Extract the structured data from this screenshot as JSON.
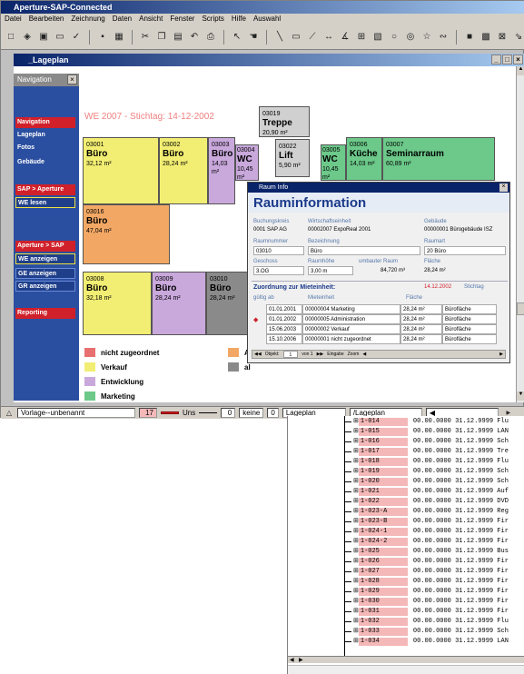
{
  "app": {
    "title": "Aperture-SAP-Connected",
    "menu": [
      "Datei",
      "Bearbeiten",
      "Zeichnung",
      "Daten",
      "Ansicht",
      "Fenster",
      "Scripts",
      "Hilfe",
      "Auswahl"
    ]
  },
  "child_window": {
    "title": "_Lageplan"
  },
  "nav_panel": {
    "title": "Navigation",
    "items": [
      "Navigation",
      "Lageplan",
      "Fotos",
      "Gebäude",
      "SAP > Aperture",
      "WE lesen",
      "Aperture > SAP",
      "WE anzeigen",
      "GE anzeigen",
      "GR anzeigen",
      "Reporting"
    ]
  },
  "plan": {
    "header": "WE 2007 - Stichtag: 14-12-2002",
    "rooms": [
      {
        "num": "03001",
        "name": "Büro",
        "area": "32,12 m²",
        "color": "#f2ee73"
      },
      {
        "num": "03002",
        "name": "Büro",
        "area": "28,24 m²",
        "color": "#f2ee73"
      },
      {
        "num": "03003",
        "name": "Büro",
        "area": "14,03 m²",
        "color": "#c9a8dc"
      },
      {
        "num": "03004",
        "name": "WC",
        "area": "10,45 m²",
        "color": "#c9a8dc"
      },
      {
        "num": "03019",
        "name": "Treppe",
        "area": "20,90 m²",
        "color": "#d0d0d0"
      },
      {
        "num": "03022",
        "name": "Lift",
        "area": "5,90 m²",
        "color": "#d0d0d0"
      },
      {
        "num": "03005",
        "name": "WC",
        "area": "10,45 m²",
        "color": "#6cc98a"
      },
      {
        "num": "03006",
        "name": "Küche",
        "area": "14,03 m²",
        "color": "#6cc98a"
      },
      {
        "num": "03007",
        "name": "Seminarraum",
        "area": "60,89 m²",
        "color": "#6cc98a"
      },
      {
        "num": "03016",
        "name": "Büro",
        "area": "47,04 m²",
        "color": "#f2a864"
      },
      {
        "num": "03008",
        "name": "Büro",
        "area": "32,18 m²",
        "color": "#f2ee73"
      },
      {
        "num": "03009",
        "name": "Büro",
        "area": "28,24 m²",
        "color": "#c9a8dc"
      },
      {
        "num": "03010",
        "name": "Büro",
        "area": "28,24 m²",
        "color": "#8a8a8a"
      }
    ],
    "legend": [
      {
        "label": "nicht zugeordnet",
        "color": "#e87070"
      },
      {
        "label": "Verkauf",
        "color": "#f2ee73"
      },
      {
        "label": "Entwicklung",
        "color": "#c9a8dc"
      },
      {
        "label": "Marketing",
        "color": "#6cc98a"
      },
      {
        "label": "A",
        "color": "#f2a864"
      },
      {
        "label": "al",
        "color": "#8a8a8a"
      }
    ]
  },
  "status_bar": {
    "vorlage": "Vorlage--unbenannt",
    "num1": "17",
    "uns": "Uns",
    "zero1": "0",
    "keine": "keine",
    "zero2": "0",
    "lageplan1": "Lageplan",
    "lageplan2": "/Lageplan"
  },
  "dialog": {
    "title": "Raum Info",
    "heading": "Rauminformation",
    "fields": {
      "buchungskreis_label": "Buchungskreis",
      "buchungskreis": "0001 SAP AG",
      "wirtschaft_label": "Wirtschaftseinheit",
      "wirtschaft": "00002007 ExpoReal 2001",
      "gebaeude_label": "Gebäude",
      "gebaeude": "00000001 Bürogebäude ISZ",
      "raumnummer_label": "Raumnummer",
      "raumnummer": "03010",
      "bezeichnung_label": "Bezeichnung",
      "bezeichnung": "Büro",
      "raumart_label": "Raumart",
      "raumart": "20 Büro",
      "geschoss_label": "Geschoss",
      "geschoss": "3.OG",
      "raumhoehe_label": "Raumhöhe",
      "raumhoehe": "3,00 m",
      "umbauter_label": "umbauter Raum",
      "umbauter": "84,720 m³",
      "flaeche_label": "Fläche",
      "flaeche": "28,24 m²"
    },
    "zuordnung_label": "Zuordnung zur Mieteinheit:",
    "stichtag_date": "14.12.2002",
    "stichtag_label": "Stichtag",
    "cols": {
      "gueltig": "gültig ab",
      "miet": "Mieteinheit",
      "flaeche": "Fläche"
    },
    "rows": [
      {
        "date": "01.01.2001",
        "unit": "00000004 Marketing",
        "area": "28,24 m²",
        "type": "Bürofläche"
      },
      {
        "date": "01.01.2002",
        "unit": "00000005 Administration",
        "area": "28,24 m²",
        "type": "Bürofläche"
      },
      {
        "date": "15.06.2003",
        "unit": "00000002 Verkauf",
        "area": "28,24 m²",
        "type": "Bürofläche"
      },
      {
        "date": "15.10.2006",
        "unit": "00000001 nicht zugeordnet",
        "area": "28,24 m²",
        "type": "Bürofläche"
      }
    ],
    "nav": {
      "objekt": "Objekt:",
      "pos": "1",
      "von": "von 1",
      "eingabe": "Eingabe",
      "zoom": "Zoom"
    }
  },
  "tree": {
    "rows": [
      {
        "id": "1-014",
        "text": "00.00.0000 31.12.9999 Flu"
      },
      {
        "id": "1-015",
        "text": "00.00.0000 31.12.9999 LAN"
      },
      {
        "id": "1-016",
        "text": "00.00.0000 31.12.9999 Sch"
      },
      {
        "id": "1-017",
        "text": "00.00.0000 31.12.9999 Tre"
      },
      {
        "id": "1-018",
        "text": "00.00.0000 31.12.9999 Flu"
      },
      {
        "id": "1-019",
        "text": "00.00.0000 31.12.9999 Sch"
      },
      {
        "id": "1-020",
        "text": "00.00.0000 31.12.9999 Sch"
      },
      {
        "id": "1-021",
        "text": "00.00.0000 31.12.9999 Auf"
      },
      {
        "id": "1-022",
        "text": "00.00.0000 31.12.9999 DVD"
      },
      {
        "id": "1-023-A",
        "text": "00.00.0000 31.12.9999 Reg"
      },
      {
        "id": "1-023-B",
        "text": "00.00.0000 31.12.9999 Fir"
      },
      {
        "id": "1-024-1",
        "text": "00.00.0000 31.12.9999 Fir"
      },
      {
        "id": "1-024-2",
        "text": "00.00.0000 31.12.9999 Fir"
      },
      {
        "id": "1-025",
        "text": "00.00.0000 31.12.9999 Bus"
      },
      {
        "id": "1-026",
        "text": "00.00.0000 31.12.9999 Fir"
      },
      {
        "id": "1-027",
        "text": "00.00.0000 31.12.9999 Fir"
      },
      {
        "id": "1-028",
        "text": "00.00.0000 31.12.9999 Fir"
      },
      {
        "id": "1-029",
        "text": "00.00.0000 31.12.9999 Fir"
      },
      {
        "id": "1-030",
        "text": "00.00.0000 31.12.9999 Fir"
      },
      {
        "id": "1-031",
        "text": "00.00.0000 31.12.9999 Fir"
      },
      {
        "id": "1-032",
        "text": "00.00.0000 31.12.9999 Flu"
      },
      {
        "id": "1-033",
        "text": "00.00.0000 31.12.9999 Sch"
      },
      {
        "id": "1-034",
        "text": "00.00.0000 31.12.9999 LAN"
      }
    ]
  }
}
